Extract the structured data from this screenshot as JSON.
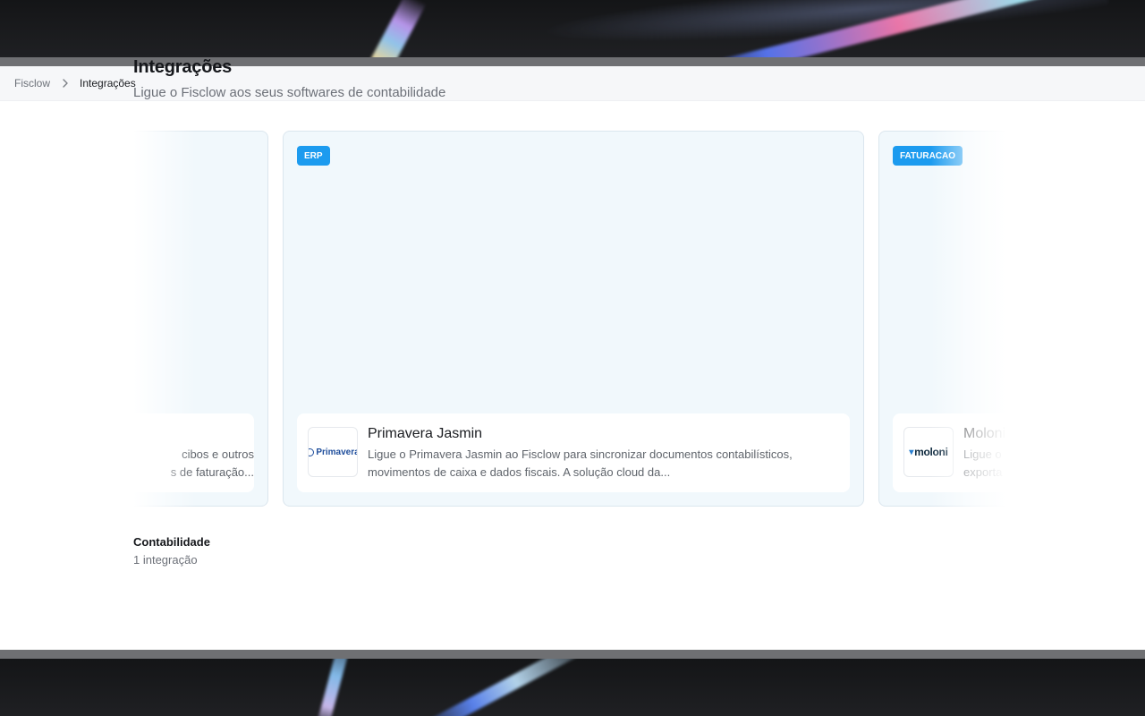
{
  "breadcrumb": {
    "root": "Fisclow",
    "current": "Integrações"
  },
  "page": {
    "title": "Integrações",
    "subtitle": "Ligue o Fisclow aos seus softwares de contabilidade"
  },
  "cards": {
    "left": {
      "desc_line1": "cibos e outros",
      "desc_line2": "s de faturação..."
    },
    "center": {
      "badge": "ERP",
      "logo": "Primavera",
      "title": "Primavera Jasmin",
      "desc": "Ligue o Primavera Jasmin ao Fisclow para sincronizar documentos contabilísticos, movimentos de caixa e dados fiscais. A solução cloud da..."
    },
    "right": {
      "badge": "FATURACAO",
      "logo": "moloni",
      "title": "Moloni",
      "desc_line1": "Ligue o",
      "desc_line2": "exporta"
    }
  },
  "section": {
    "title": "Contabilidade",
    "count": "1 integração"
  },
  "colors": {
    "badge": "#1c9bef",
    "card_bg": "#f1f8fc",
    "primavera": "#1f4e9c"
  },
  "icons": {
    "breadcrumb_separator": "chevron-right-icon"
  }
}
